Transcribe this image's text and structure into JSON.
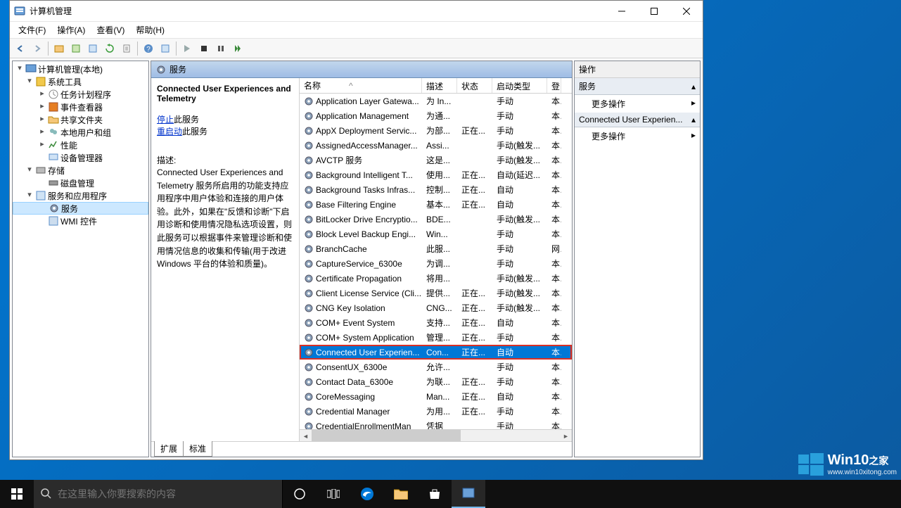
{
  "window": {
    "title": "计算机管理",
    "menu": [
      "文件(F)",
      "操作(A)",
      "查看(V)",
      "帮助(H)"
    ]
  },
  "tree": {
    "root": "计算机管理(本地)",
    "systools": "系统工具",
    "task": "任务计划程序",
    "event": "事件查看器",
    "shared": "共享文件夹",
    "users": "本地用户和组",
    "perf": "性能",
    "device": "设备管理器",
    "storage": "存储",
    "disk": "磁盘管理",
    "svcapps": "服务和应用程序",
    "services": "服务",
    "wmi": "WMI 控件"
  },
  "services_header": {
    "title": "服务",
    "col_name": "名称",
    "col_desc": "描述",
    "col_state": "状态",
    "col_start": "启动类型",
    "col_last": "登"
  },
  "detail": {
    "name": "Connected User Experiences and Telemetry",
    "stop": "停止",
    "stop_suffix": "此服务",
    "restart": "重启动",
    "restart_suffix": "此服务",
    "desc_label": "描述:",
    "desc": "Connected User Experiences and Telemetry 服务所启用的功能支持应用程序中用户体验和连接的用户体验。此外，如果在\"反馈和诊断\"下启用诊断和使用情况隐私选项设置，则此服务可以根据事件来管理诊断和使用情况信息的收集和传输(用于改进 Windows 平台的体验和质量)。"
  },
  "rows": [
    {
      "name": "Application Layer Gatewa...",
      "desc": "为 In...",
      "state": "",
      "start": "手动",
      "log": "本"
    },
    {
      "name": "Application Management",
      "desc": "为通...",
      "state": "",
      "start": "手动",
      "log": "本"
    },
    {
      "name": "AppX Deployment Servic...",
      "desc": "为部...",
      "state": "正在...",
      "start": "手动",
      "log": "本"
    },
    {
      "name": "AssignedAccessManager...",
      "desc": "Assi...",
      "state": "",
      "start": "手动(触发...",
      "log": "本"
    },
    {
      "name": "AVCTP 服务",
      "desc": "这是...",
      "state": "",
      "start": "手动(触发...",
      "log": "本"
    },
    {
      "name": "Background Intelligent T...",
      "desc": "使用...",
      "state": "正在...",
      "start": "自动(延迟...",
      "log": "本"
    },
    {
      "name": "Background Tasks Infras...",
      "desc": "控制...",
      "state": "正在...",
      "start": "自动",
      "log": "本"
    },
    {
      "name": "Base Filtering Engine",
      "desc": "基本...",
      "state": "正在...",
      "start": "自动",
      "log": "本"
    },
    {
      "name": "BitLocker Drive Encryptio...",
      "desc": "BDE...",
      "state": "",
      "start": "手动(触发...",
      "log": "本"
    },
    {
      "name": "Block Level Backup Engi...",
      "desc": "Win...",
      "state": "",
      "start": "手动",
      "log": "本"
    },
    {
      "name": "BranchCache",
      "desc": "此服...",
      "state": "",
      "start": "手动",
      "log": "网"
    },
    {
      "name": "CaptureService_6300e",
      "desc": "为调...",
      "state": "",
      "start": "手动",
      "log": "本"
    },
    {
      "name": "Certificate Propagation",
      "desc": "将用...",
      "state": "",
      "start": "手动(触发...",
      "log": "本"
    },
    {
      "name": "Client License Service (Cli...",
      "desc": "提供...",
      "state": "正在...",
      "start": "手动(触发...",
      "log": "本"
    },
    {
      "name": "CNG Key Isolation",
      "desc": "CNG...",
      "state": "正在...",
      "start": "手动(触发...",
      "log": "本"
    },
    {
      "name": "COM+ Event System",
      "desc": "支持...",
      "state": "正在...",
      "start": "自动",
      "log": "本"
    },
    {
      "name": "COM+ System Application",
      "desc": "管理...",
      "state": "正在...",
      "start": "手动",
      "log": "本"
    },
    {
      "name": "Connected User Experien...",
      "desc": "Con...",
      "state": "正在...",
      "start": "自动",
      "log": "本",
      "selected": true,
      "highlight": true
    },
    {
      "name": "ConsentUX_6300e",
      "desc": "允许...",
      "state": "",
      "start": "手动",
      "log": "本"
    },
    {
      "name": "Contact Data_6300e",
      "desc": "为联...",
      "state": "正在...",
      "start": "手动",
      "log": "本"
    },
    {
      "name": "CoreMessaging",
      "desc": "Man...",
      "state": "正在...",
      "start": "自动",
      "log": "本"
    },
    {
      "name": "Credential Manager",
      "desc": "为用...",
      "state": "正在...",
      "start": "手动",
      "log": "本"
    },
    {
      "name": "CredentialEnrollmentMan",
      "desc": "凭据",
      "state": "",
      "start": "手动",
      "log": "本"
    }
  ],
  "tabs": {
    "ext": "扩展",
    "std": "标准"
  },
  "actions": {
    "header": "操作",
    "section1": "服务",
    "more1": "更多操作",
    "section2": "Connected User Experien...",
    "more2": "更多操作"
  },
  "search_placeholder": "在这里输入你要搜索的内容",
  "watermark": {
    "title": "Win10",
    "sub": "之家",
    "url": "www.win10xitong.com"
  }
}
